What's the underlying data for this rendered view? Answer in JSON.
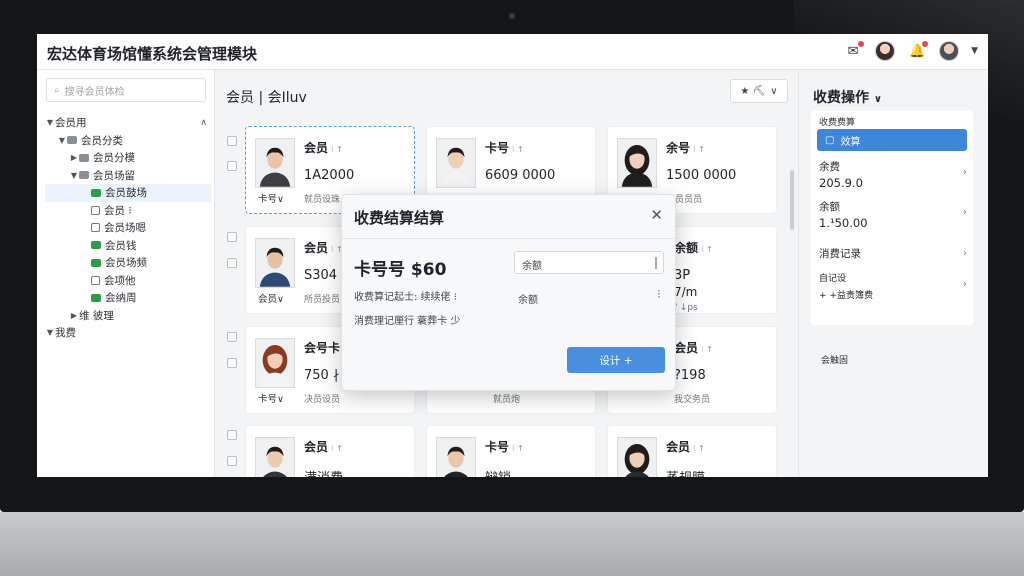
{
  "app": {
    "title": "宏达体育场馆懂系统会管理模块"
  },
  "sidebar": {
    "search_placeholder": "搜寻会员体检",
    "tree": [
      {
        "label": "会员用",
        "caret": "▼",
        "icon": "none",
        "level": 0
      },
      {
        "label": "会员分类",
        "caret": "▼",
        "icon": "grey",
        "level": 1
      },
      {
        "label": "会员分模",
        "caret": "▶",
        "icon": "grey",
        "level": 2
      },
      {
        "label": "会员场留",
        "caret": "▼",
        "icon": "grey",
        "level": 2
      },
      {
        "label": "会员鼓场",
        "caret": "",
        "icon": "green",
        "level": 3
      },
      {
        "label": "会员 ⁝",
        "caret": "",
        "icon": "box",
        "level": 3
      },
      {
        "label": "会员场嗯",
        "caret": "",
        "icon": "box",
        "level": 3
      },
      {
        "label": "会员钱",
        "caret": "",
        "icon": "green",
        "level": 3
      },
      {
        "label": "会员场频",
        "caret": "",
        "icon": "green",
        "level": 3
      },
      {
        "label": "会项他",
        "caret": "",
        "icon": "box",
        "level": 3
      },
      {
        "label": "会纳周",
        "caret": "",
        "icon": "green",
        "level": 3
      },
      {
        "label": "维 彼理",
        "caret": "▶",
        "icon": "none",
        "level": 2
      },
      {
        "label": "我费",
        "caret": "▼",
        "icon": "none",
        "level": 0
      }
    ]
  },
  "main": {
    "breadcrumb": "会员 | 会Iluv",
    "filter_icons": "★ ⛏",
    "cards": [
      {
        "title": "会员",
        "sub": "⁝ ↑",
        "value": "1A2000",
        "label": "卡号∨",
        "meta": "就员设珠",
        "avatar": "m1"
      },
      {
        "title": "卡号",
        "sub": "⁝ ↑",
        "value": "6609 0000",
        "label": "",
        "meta": "",
        "avatar": "m2"
      },
      {
        "title": "余号",
        "sub": "⁝ ↑",
        "value": "1500 0000",
        "label": "",
        "meta": "就员员员",
        "avatar": "f1"
      },
      {
        "title": "会员",
        "sub": "⁝ ↑",
        "value": "S304 6",
        "label": "会员∨",
        "meta": "所员投员",
        "avatar": "m3"
      },
      {
        "title": "",
        "sub": "",
        "value": "",
        "label": "",
        "meta": "",
        "avatar": "none"
      },
      {
        "title": "余额",
        "sub": "⁝ ↑",
        "value": "3P",
        "label": "",
        "meta": "",
        "avatar": "none"
      },
      {
        "title": "会号卡",
        "sub": "",
        "value": "750 ∤",
        "label": "卡号∨",
        "meta": "决员设员",
        "avatar": "f2"
      },
      {
        "title": "",
        "sub": "",
        "value": "",
        "label": "",
        "meta": "就员炮",
        "avatar": "none"
      },
      {
        "title": "会员",
        "sub": "⁝ ↑",
        "value": "?198",
        "label": "",
        "meta": "我交务员",
        "avatar": "none"
      },
      {
        "title": "会员",
        "sub": "⁝ ↑",
        "value": "满消费",
        "label": "",
        "meta": "",
        "avatar": "m4"
      },
      {
        "title": "卡号",
        "sub": "⁝ ↑",
        "value": "辩销",
        "label": "",
        "meta": "",
        "avatar": "m5"
      },
      {
        "title": "会员",
        "sub": "⁝ ↑",
        "value": "蒸规膜",
        "label": "",
        "meta": "",
        "avatar": "f3"
      }
    ],
    "extra_lines": {
      "card6_line2": "7/m",
      "card6_line3": "/ ↓ps"
    }
  },
  "modal": {
    "title": "收费结算结算",
    "close": "✕",
    "amount": "卡号号 $60",
    "line1": "收费算记起士: 续续佬 ⁝",
    "line2": "消费理记厘行  蓑葬卡 少",
    "input_value": "余额",
    "field_label": "余额",
    "kebab": "⁝",
    "button": "设计 +"
  },
  "right_panel": {
    "title": "收费操作",
    "section_label": "收费费算",
    "active_item": "效算",
    "rows": [
      {
        "key": "余费",
        "value": "205.9.0"
      },
      {
        "key": "余额",
        "value": "1.¹50.00"
      }
    ],
    "records_label": "消费记录",
    "records_sub1": "自记设",
    "records_sub2": "+ +益贵簿费",
    "bottom_label": "会触固"
  },
  "colors": {
    "accent": "#3d86d8",
    "primary_button": "#4a8fdc",
    "green_icon": "#2e9d4a",
    "notification_dot": "#e34b4b"
  }
}
